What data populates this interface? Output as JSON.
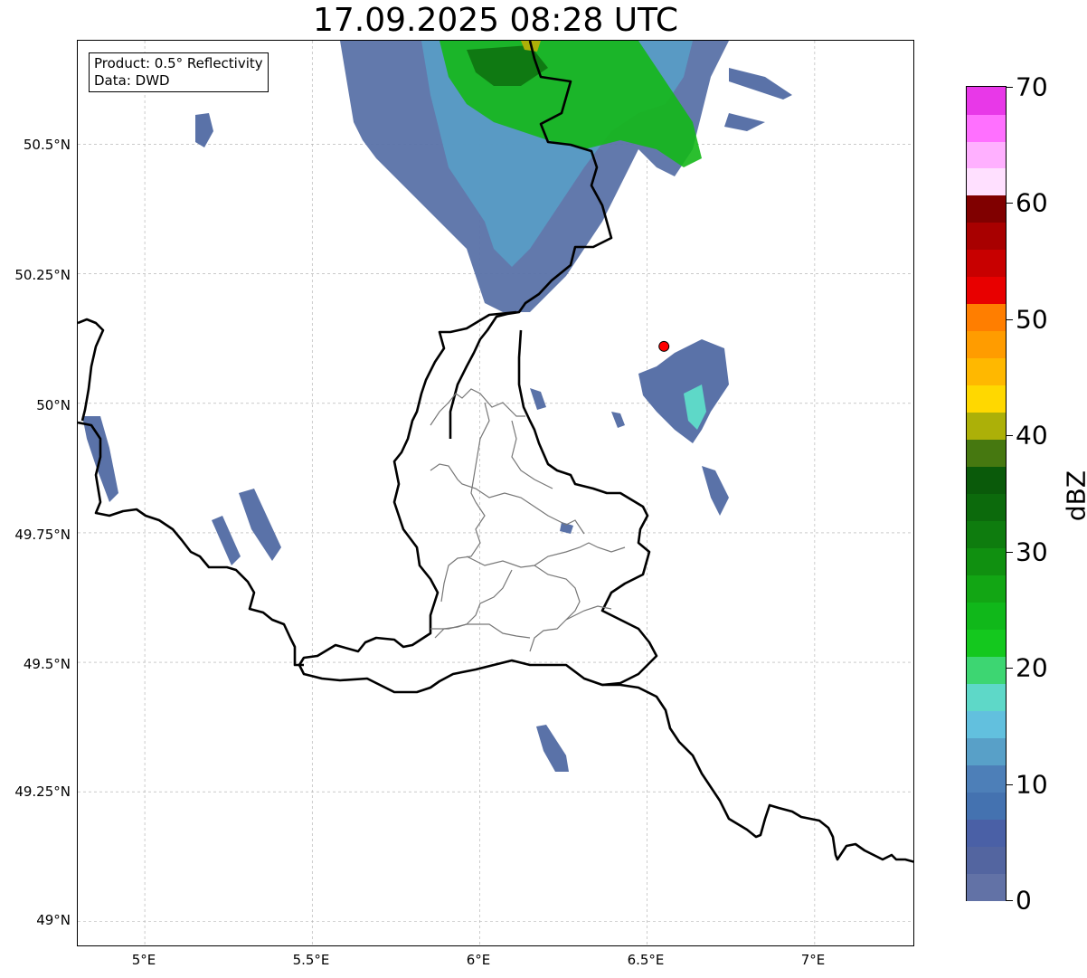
{
  "title": "17.09.2025 08:28 UTC",
  "info": {
    "product": "Product: 0.5° Reflectivity",
    "data": "Data: DWD"
  },
  "axes": {
    "lat_labels": [
      "50.5°N",
      "50.25°N",
      "50°N",
      "49.75°N",
      "49.5°N",
      "49.25°N",
      "49°N"
    ],
    "lon_labels": [
      "5°E",
      "5.5°E",
      "6°E",
      "6.5°E",
      "7°E"
    ]
  },
  "extent": {
    "lon_min": 4.8,
    "lon_max": 7.3,
    "lat_min": 48.95,
    "lat_max": 50.7
  },
  "marker": {
    "lon": 6.55,
    "lat": 50.11,
    "color": "#ff0000"
  },
  "colorbar": {
    "label": "dBZ",
    "min": 0,
    "max": 70,
    "tick_labels": [
      "0",
      "10",
      "20",
      "30",
      "40",
      "50",
      "60",
      "70"
    ],
    "colors": [
      "#6272a6",
      "#5365a0",
      "#4a60a6",
      "#4472b0",
      "#4d7fb8",
      "#58a0c8",
      "#62c0de",
      "#5ed8c8",
      "#3dd672",
      "#14c81e",
      "#10b81a",
      "#12a614",
      "#109010",
      "#0e7c0e",
      "#0c6a0c",
      "#0a5a0a",
      "#467810",
      "#acb008",
      "#ffd800",
      "#ffb800",
      "#ff9c00",
      "#ff7e00",
      "#e80000",
      "#c80000",
      "#a80000",
      "#800000",
      "#ffe0ff",
      "#ffb0ff",
      "#ff70ff",
      "#e838e8"
    ]
  },
  "chart_data": {
    "type": "map",
    "title": "17.09.2025 08:28 UTC",
    "xlabel": "",
    "ylabel": "",
    "xlim": [
      4.8,
      7.3
    ],
    "ylim": [
      48.95,
      50.7
    ],
    "grid": true,
    "colorbar_label": "dBZ",
    "colorbar_range": [
      0,
      70
    ]
  }
}
